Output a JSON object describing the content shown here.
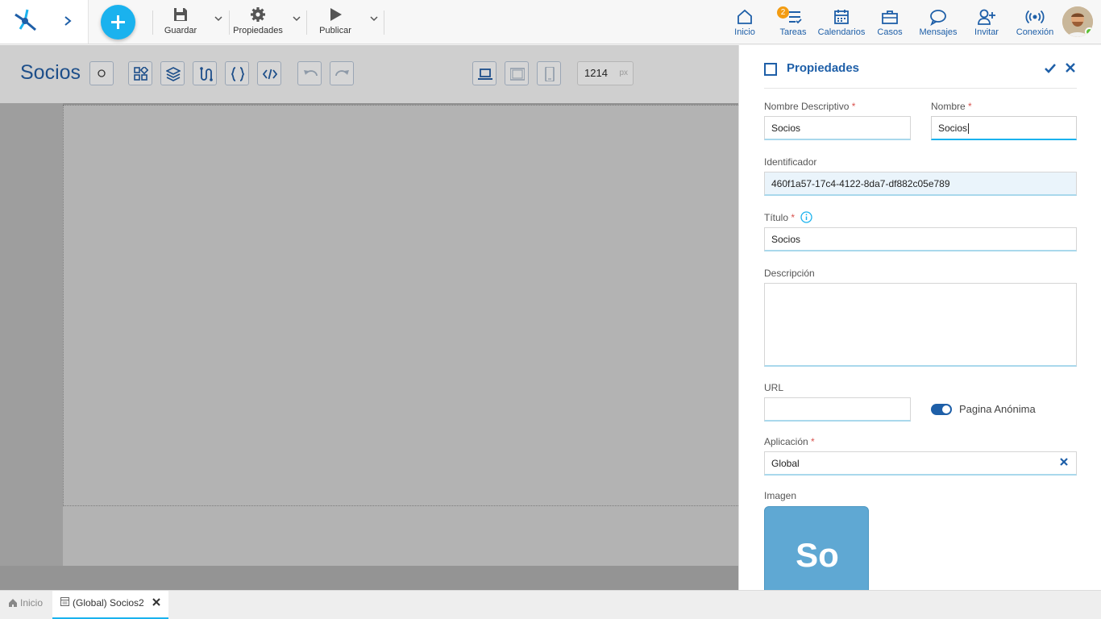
{
  "toolbar": {
    "save_label": "Guardar",
    "properties_label": "Propiedades",
    "publish_label": "Publicar"
  },
  "nav": {
    "items": [
      {
        "label": "Inicio",
        "icon": "home-icon"
      },
      {
        "label": "Tareas",
        "icon": "tasks-icon",
        "badge": "2"
      },
      {
        "label": "Calendarios",
        "icon": "calendar-icon"
      },
      {
        "label": "Casos",
        "icon": "briefcase-icon"
      },
      {
        "label": "Mensajes",
        "icon": "chat-icon"
      },
      {
        "label": "Invitar",
        "icon": "invite-user-icon"
      },
      {
        "label": "Conexión",
        "icon": "connection-icon"
      }
    ]
  },
  "editor": {
    "page_title": "Socios",
    "width_value": "1214",
    "width_unit": "px"
  },
  "panel": {
    "title": "Propiedades",
    "fields": {
      "nombre_descriptivo": {
        "label": "Nombre Descriptivo",
        "value": "Socios"
      },
      "nombre": {
        "label": "Nombre",
        "value": "Socios"
      },
      "identificador": {
        "label": "Identificador",
        "value": "460f1a57-17c4-4122-8da7-df882c05e789"
      },
      "titulo": {
        "label": "Título",
        "value": "Socios"
      },
      "descripcion": {
        "label": "Descripción",
        "value": ""
      },
      "url": {
        "label": "URL",
        "value": ""
      },
      "pagina_anonima": {
        "label": "Pagina Anónima",
        "on": true
      },
      "aplicacion": {
        "label": "Aplicación",
        "value": "Global"
      },
      "imagen": {
        "label": "Imagen",
        "tile_text": "So"
      }
    },
    "required_mark": "*"
  },
  "bottom_tabs": {
    "home": "Inicio",
    "active": "(Global) Socios2"
  },
  "colors": {
    "accent": "#1ab2ee",
    "brand_blue": "#1e5fa8",
    "badge": "#f39c12",
    "image_tile": "#5fa8d3"
  }
}
